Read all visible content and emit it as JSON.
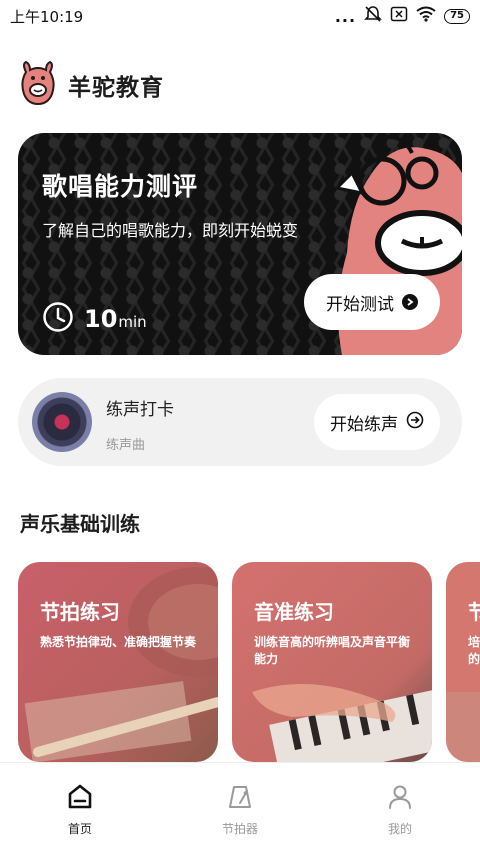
{
  "status_bar": {
    "time": "上午10:19",
    "dots": "...",
    "battery": "75"
  },
  "header": {
    "app_name": "羊驼教育",
    "logo_icon": "alpaca-logo-icon"
  },
  "hero": {
    "title": "歌唱能力测评",
    "subtitle": "了解自己的唱歌能力，即刻开始蜕变",
    "duration_value": "10",
    "duration_unit": "min",
    "button_label": "开始测试",
    "colors": {
      "background": "#111111",
      "mascot": "#e28380"
    }
  },
  "practice": {
    "title": "练声打卡",
    "subtitle": "练声曲",
    "button_label": "开始练声",
    "icon": "vinyl-record-icon"
  },
  "section": {
    "title": "声乐基础训练"
  },
  "courses": [
    {
      "title": "节拍练习",
      "desc": "熟悉节拍律动、准确把握节奏"
    },
    {
      "title": "音准练习",
      "desc": "训练音高的听辨唱及声音平衡能力"
    },
    {
      "title": "节",
      "desc": "培的"
    }
  ],
  "bottom_nav": {
    "items": [
      {
        "label": "首页",
        "icon": "home-icon",
        "active": true
      },
      {
        "label": "节拍器",
        "icon": "metronome-icon",
        "active": false
      },
      {
        "label": "我的",
        "icon": "profile-icon",
        "active": false
      }
    ]
  }
}
